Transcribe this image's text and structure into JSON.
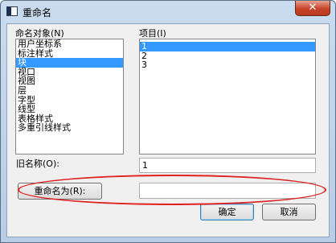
{
  "window": {
    "title": "重命名",
    "close_glyph": "✕"
  },
  "left_list": {
    "label": "命名对象(N)",
    "items": [
      "用户坐标系",
      "标注样式",
      "块",
      "视口",
      "视图",
      "层",
      "字型",
      "线型",
      "表格样式",
      "多重引线样式"
    ],
    "selected_index": 2
  },
  "right_list": {
    "label": "项目(I)",
    "items": [
      "1",
      "2",
      "3"
    ],
    "selected_index": 0
  },
  "old_name": {
    "label": "旧名称(O):",
    "value": "1"
  },
  "rename_to": {
    "button_label": "重命名为(R):",
    "value": ""
  },
  "buttons": {
    "ok": "确定",
    "cancel": "取消"
  },
  "colors": {
    "selection": "#3399ff",
    "annotation_ring": "#e02020",
    "close_button": "#c7432a"
  }
}
